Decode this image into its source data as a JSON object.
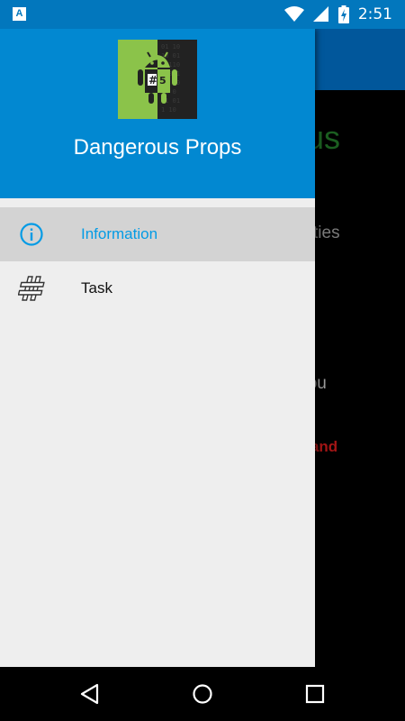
{
  "status_bar": {
    "notification_icon": "a-icon",
    "time": "2:51",
    "icons": [
      "wifi-icon",
      "signal-icon",
      "battery-charging-icon"
    ]
  },
  "background_app": {
    "title_fragment": "ous",
    "line1_fragment": "operties",
    "line2_fragment": "e, You",
    "line3_fragment": "ops and"
  },
  "drawer": {
    "app_name": "Dangerous Props",
    "app_icon": "android-hash-5-icon",
    "menu": [
      {
        "label": "Information",
        "icon": "info-icon",
        "selected": true
      },
      {
        "label": "Task",
        "icon": "hash-icon",
        "selected": false
      }
    ]
  },
  "nav_bar": {
    "buttons": [
      "back-icon",
      "home-icon",
      "recents-icon"
    ]
  },
  "colors": {
    "header": "#0288d1",
    "status_bar": "#0277bd",
    "accent": "#039be5",
    "drawer_bg": "#eeeeee",
    "selected_bg": "#d3d3d3"
  }
}
